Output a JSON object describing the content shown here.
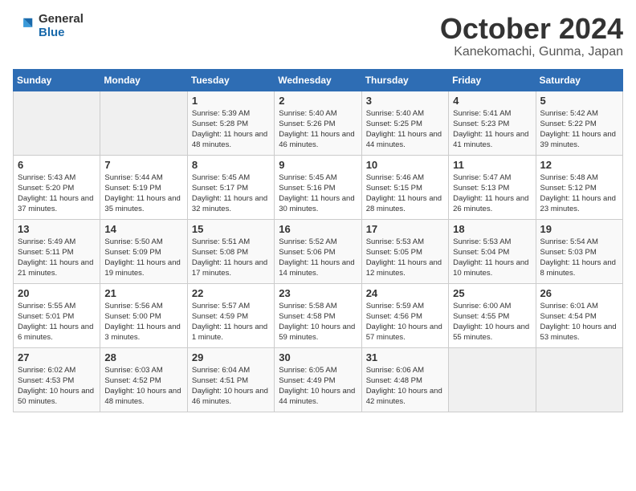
{
  "logo": {
    "general": "General",
    "blue": "Blue"
  },
  "title": "October 2024",
  "location": "Kanekomachi, Gunma, Japan",
  "weekdays": [
    "Sunday",
    "Monday",
    "Tuesday",
    "Wednesday",
    "Thursday",
    "Friday",
    "Saturday"
  ],
  "weeks": [
    [
      {
        "day": "",
        "sunrise": "",
        "sunset": "",
        "daylight": ""
      },
      {
        "day": "",
        "sunrise": "",
        "sunset": "",
        "daylight": ""
      },
      {
        "day": "1",
        "sunrise": "Sunrise: 5:39 AM",
        "sunset": "Sunset: 5:28 PM",
        "daylight": "Daylight: 11 hours and 48 minutes."
      },
      {
        "day": "2",
        "sunrise": "Sunrise: 5:40 AM",
        "sunset": "Sunset: 5:26 PM",
        "daylight": "Daylight: 11 hours and 46 minutes."
      },
      {
        "day": "3",
        "sunrise": "Sunrise: 5:40 AM",
        "sunset": "Sunset: 5:25 PM",
        "daylight": "Daylight: 11 hours and 44 minutes."
      },
      {
        "day": "4",
        "sunrise": "Sunrise: 5:41 AM",
        "sunset": "Sunset: 5:23 PM",
        "daylight": "Daylight: 11 hours and 41 minutes."
      },
      {
        "day": "5",
        "sunrise": "Sunrise: 5:42 AM",
        "sunset": "Sunset: 5:22 PM",
        "daylight": "Daylight: 11 hours and 39 minutes."
      }
    ],
    [
      {
        "day": "6",
        "sunrise": "Sunrise: 5:43 AM",
        "sunset": "Sunset: 5:20 PM",
        "daylight": "Daylight: 11 hours and 37 minutes."
      },
      {
        "day": "7",
        "sunrise": "Sunrise: 5:44 AM",
        "sunset": "Sunset: 5:19 PM",
        "daylight": "Daylight: 11 hours and 35 minutes."
      },
      {
        "day": "8",
        "sunrise": "Sunrise: 5:45 AM",
        "sunset": "Sunset: 5:17 PM",
        "daylight": "Daylight: 11 hours and 32 minutes."
      },
      {
        "day": "9",
        "sunrise": "Sunrise: 5:45 AM",
        "sunset": "Sunset: 5:16 PM",
        "daylight": "Daylight: 11 hours and 30 minutes."
      },
      {
        "day": "10",
        "sunrise": "Sunrise: 5:46 AM",
        "sunset": "Sunset: 5:15 PM",
        "daylight": "Daylight: 11 hours and 28 minutes."
      },
      {
        "day": "11",
        "sunrise": "Sunrise: 5:47 AM",
        "sunset": "Sunset: 5:13 PM",
        "daylight": "Daylight: 11 hours and 26 minutes."
      },
      {
        "day": "12",
        "sunrise": "Sunrise: 5:48 AM",
        "sunset": "Sunset: 5:12 PM",
        "daylight": "Daylight: 11 hours and 23 minutes."
      }
    ],
    [
      {
        "day": "13",
        "sunrise": "Sunrise: 5:49 AM",
        "sunset": "Sunset: 5:11 PM",
        "daylight": "Daylight: 11 hours and 21 minutes."
      },
      {
        "day": "14",
        "sunrise": "Sunrise: 5:50 AM",
        "sunset": "Sunset: 5:09 PM",
        "daylight": "Daylight: 11 hours and 19 minutes."
      },
      {
        "day": "15",
        "sunrise": "Sunrise: 5:51 AM",
        "sunset": "Sunset: 5:08 PM",
        "daylight": "Daylight: 11 hours and 17 minutes."
      },
      {
        "day": "16",
        "sunrise": "Sunrise: 5:52 AM",
        "sunset": "Sunset: 5:06 PM",
        "daylight": "Daylight: 11 hours and 14 minutes."
      },
      {
        "day": "17",
        "sunrise": "Sunrise: 5:53 AM",
        "sunset": "Sunset: 5:05 PM",
        "daylight": "Daylight: 11 hours and 12 minutes."
      },
      {
        "day": "18",
        "sunrise": "Sunrise: 5:53 AM",
        "sunset": "Sunset: 5:04 PM",
        "daylight": "Daylight: 11 hours and 10 minutes."
      },
      {
        "day": "19",
        "sunrise": "Sunrise: 5:54 AM",
        "sunset": "Sunset: 5:03 PM",
        "daylight": "Daylight: 11 hours and 8 minutes."
      }
    ],
    [
      {
        "day": "20",
        "sunrise": "Sunrise: 5:55 AM",
        "sunset": "Sunset: 5:01 PM",
        "daylight": "Daylight: 11 hours and 6 minutes."
      },
      {
        "day": "21",
        "sunrise": "Sunrise: 5:56 AM",
        "sunset": "Sunset: 5:00 PM",
        "daylight": "Daylight: 11 hours and 3 minutes."
      },
      {
        "day": "22",
        "sunrise": "Sunrise: 5:57 AM",
        "sunset": "Sunset: 4:59 PM",
        "daylight": "Daylight: 11 hours and 1 minute."
      },
      {
        "day": "23",
        "sunrise": "Sunrise: 5:58 AM",
        "sunset": "Sunset: 4:58 PM",
        "daylight": "Daylight: 10 hours and 59 minutes."
      },
      {
        "day": "24",
        "sunrise": "Sunrise: 5:59 AM",
        "sunset": "Sunset: 4:56 PM",
        "daylight": "Daylight: 10 hours and 57 minutes."
      },
      {
        "day": "25",
        "sunrise": "Sunrise: 6:00 AM",
        "sunset": "Sunset: 4:55 PM",
        "daylight": "Daylight: 10 hours and 55 minutes."
      },
      {
        "day": "26",
        "sunrise": "Sunrise: 6:01 AM",
        "sunset": "Sunset: 4:54 PM",
        "daylight": "Daylight: 10 hours and 53 minutes."
      }
    ],
    [
      {
        "day": "27",
        "sunrise": "Sunrise: 6:02 AM",
        "sunset": "Sunset: 4:53 PM",
        "daylight": "Daylight: 10 hours and 50 minutes."
      },
      {
        "day": "28",
        "sunrise": "Sunrise: 6:03 AM",
        "sunset": "Sunset: 4:52 PM",
        "daylight": "Daylight: 10 hours and 48 minutes."
      },
      {
        "day": "29",
        "sunrise": "Sunrise: 6:04 AM",
        "sunset": "Sunset: 4:51 PM",
        "daylight": "Daylight: 10 hours and 46 minutes."
      },
      {
        "day": "30",
        "sunrise": "Sunrise: 6:05 AM",
        "sunset": "Sunset: 4:49 PM",
        "daylight": "Daylight: 10 hours and 44 minutes."
      },
      {
        "day": "31",
        "sunrise": "Sunrise: 6:06 AM",
        "sunset": "Sunset: 4:48 PM",
        "daylight": "Daylight: 10 hours and 42 minutes."
      },
      {
        "day": "",
        "sunrise": "",
        "sunset": "",
        "daylight": ""
      },
      {
        "day": "",
        "sunrise": "",
        "sunset": "",
        "daylight": ""
      }
    ]
  ]
}
